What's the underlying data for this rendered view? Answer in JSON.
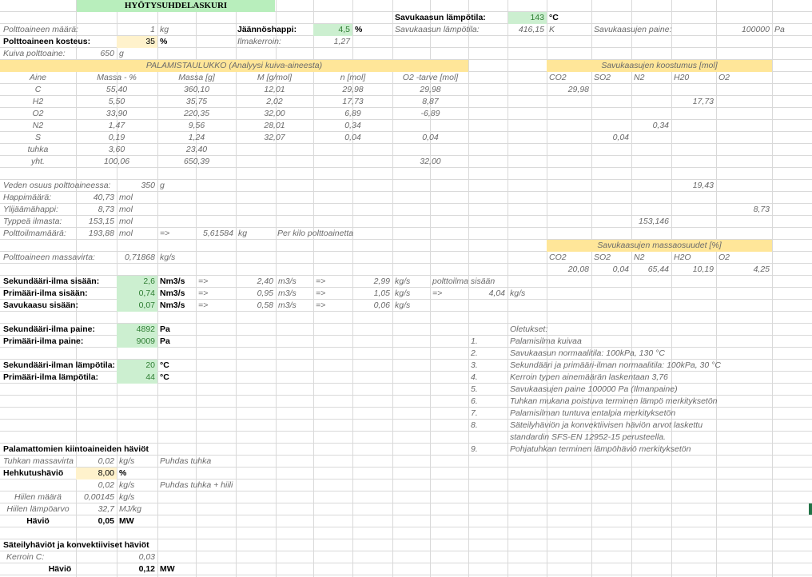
{
  "title": "HYÖTYSUHDELASKURI",
  "r1": {
    "savu_lbl": "Savukaasun lämpötila:",
    "savu_val": "143",
    "savu_unit": "°C"
  },
  "r2": {
    "maara_lbl": "Polttoaineen määrä:",
    "maara_val": "1",
    "maara_unit": "kg",
    "jaann_lbl": "Jäännöshappi:",
    "jaann_val": "4,5",
    "jaann_unit": "%",
    "savu_lbl": "Savukaasun lämpötila:",
    "savu_val": "416,15",
    "savu_unit": "K",
    "paine_lbl": "Savukaasujen paine:",
    "paine_val": "100000",
    "paine_unit": "Pa"
  },
  "r3": {
    "kost_lbl": "Polttoaineen kosteus:",
    "kost_val": "35",
    "kost_unit": "%",
    "ilma_lbl": "Ilmakerroin:",
    "ilma_val": "1,27"
  },
  "r4": {
    "kuiva_lbl": "Kuiva polttoaine:",
    "kuiva_val": "650",
    "kuiva_unit": "g"
  },
  "pala": {
    "header": "PALAMISTAULUKKO (Analyysi kuiva-aineesta)",
    "cols": [
      "Aine",
      "Massa - %",
      "Massa [g]",
      "M [g/mol]",
      "n [mol]",
      "O2 -tarve [mol]"
    ],
    "rows": [
      [
        "C",
        "55,40",
        "360,10",
        "12,01",
        "29,98",
        "29,98"
      ],
      [
        "H2",
        "5,50",
        "35,75",
        "2,02",
        "17,73",
        "8,87"
      ],
      [
        "O2",
        "33,90",
        "220,35",
        "32,00",
        "6,89",
        "-6,89"
      ],
      [
        "N2",
        "1,47",
        "9,56",
        "28,01",
        "0,34",
        ""
      ],
      [
        "S",
        "0,19",
        "1,24",
        "32,07",
        "0,04",
        "0,04"
      ],
      [
        "tuhka",
        "3,60",
        "23,40",
        "",
        "",
        ""
      ],
      [
        "yht.",
        "100,06",
        "650,39",
        "",
        "",
        "32,00"
      ]
    ]
  },
  "koost": {
    "header": "Savukaasujen koostumus [mol]",
    "cols": [
      "CO2",
      "SO2",
      "N2",
      "H20",
      "O2"
    ],
    "c": "29,98",
    "h2o": "17,73",
    "n2": "0,34",
    "so2": "0,04",
    "h2o2": "19,43",
    "o2": "8,73",
    "n2b": "153,146"
  },
  "vesi": {
    "lbl": "Veden osuus polttoaineessa:",
    "val": "350",
    "unit": "g"
  },
  "happi": {
    "lbl": "Happimäärä:",
    "val": "40,73",
    "unit": "mol"
  },
  "ylij": {
    "lbl": "Ylijäämähappi:",
    "val": "8,73",
    "unit": "mol"
  },
  "typpi": {
    "lbl": "Typpeä ilmasta:",
    "val": "153,15",
    "unit": "mol"
  },
  "poltto": {
    "lbl": "Polttoilmamäärä:",
    "val": "193,88",
    "unit": "mol",
    "arrow": "=>",
    "val2": "5,61584",
    "unit2": "kg",
    "note": "Per kilo polttoainetta"
  },
  "massa": {
    "header": "Savukaasujen massaosuudet [%]",
    "cols": [
      "CO2",
      "SO2",
      "N2",
      "H2O",
      "O2"
    ],
    "vals": [
      "20,08",
      "0,04",
      "65,44",
      "10,19",
      "4,25"
    ]
  },
  "massavirta": {
    "lbl": "Polttoaineen massavirta:",
    "val": "0,71868",
    "unit": "kg/s"
  },
  "sek": {
    "lbl": "Sekundääri-ilma sisään:",
    "val": "2,6",
    "unit": "Nm3/s",
    "a1": "=>",
    "v2": "2,40",
    "u2": "m3/s",
    "a2": "=>",
    "v3": "2,99",
    "u3": "kg/s",
    "note": "polttoilma sisään"
  },
  "prim": {
    "lbl": "Primääri-ilma sisään:",
    "val": "0,74",
    "unit": "Nm3/s",
    "a1": "=>",
    "v2": "0,95",
    "u2": "m3/s",
    "a2": "=>",
    "v3": "1,05",
    "u3": "kg/s",
    "a3": "=>",
    "v4": "4,04",
    "u4": "kg/s"
  },
  "savuin": {
    "lbl": "Savukaasu sisään:",
    "val": "0,07",
    "unit": "Nm3/s",
    "a1": "=>",
    "v2": "0,58",
    "u2": "m3/s",
    "a2": "=>",
    "v3": "0,06",
    "u3": "kg/s"
  },
  "sekp": {
    "lbl": "Sekundääri-ilma paine:",
    "val": "4892",
    "unit": "Pa"
  },
  "primp": {
    "lbl": "Primääri-ilma paine:",
    "val": "9009",
    "unit": "Pa"
  },
  "sekt": {
    "lbl": "Sekundääri-ilman lämpötila:",
    "val": "20",
    "unit": "°C"
  },
  "primt": {
    "lbl": "Primääri-ilma lämpötila:",
    "val": "44",
    "unit": "°C"
  },
  "olet": {
    "header": "Oletukset:",
    "items": [
      [
        "1.",
        "Palamisilma kuivaa"
      ],
      [
        "2.",
        "Savukaasun normaalitila: 100kPa, 130 °C"
      ],
      [
        "3.",
        "Sekundääri ja primääri-ilman normaalitila: 100kPa, 30 °C"
      ],
      [
        "4.",
        "Kerroin typen ainemäärän laskentaan 3,76"
      ],
      [
        "5.",
        "Savukaasujen paine 100000 Pa (Ilmanpaine)"
      ],
      [
        "6.",
        "Tuhkan mukana poistuva terminen lämpö merkityksetön"
      ],
      [
        "7.",
        "Palamisilman tuntuva entalpia merkityksetön"
      ],
      [
        "8.",
        "Säteilyhäviön ja konvektiivisen häviön arvot laskettu"
      ],
      [
        "",
        "standardin SFS-EN 12952-15 perusteella."
      ],
      [
        "9.",
        "Pohjatuhkan terminen lämpöhäviö merkityksetön"
      ]
    ]
  },
  "kiinto": {
    "header": "Palamattomien kiintoaineiden häviöt",
    "tuhka_lbl": "Tuhkan massavirta",
    "tuhka_val": "0,02",
    "tuhka_unit": "kg/s",
    "tuhka_note": "Puhdas tuhka",
    "hehku_lbl": "Hehkutushäviö",
    "hehku_val": "8,00",
    "hehku_unit": "%",
    "v2": "0,02",
    "u2": "kg/s",
    "n2": "Puhdas tuhka + hiili",
    "hiili_lbl": "Hiilen määrä",
    "hiili_val": "0,00145",
    "hiili_unit": "kg/s",
    "lamp_lbl": "Hiilen lämpöarvo",
    "lamp_val": "32,7",
    "lamp_unit": "MJ/kg",
    "hav_lbl": "Häviö",
    "hav_val": "0,05",
    "hav_unit": "MW"
  },
  "sateily": {
    "header": "Säteilyhäviöt ja konvektiiviset häviöt",
    "kerr_lbl": "Kerroin C:",
    "kerr_val": "0,03",
    "hav_lbl": "Häviö",
    "hav_val": "0,12",
    "hav_unit": "MW"
  }
}
